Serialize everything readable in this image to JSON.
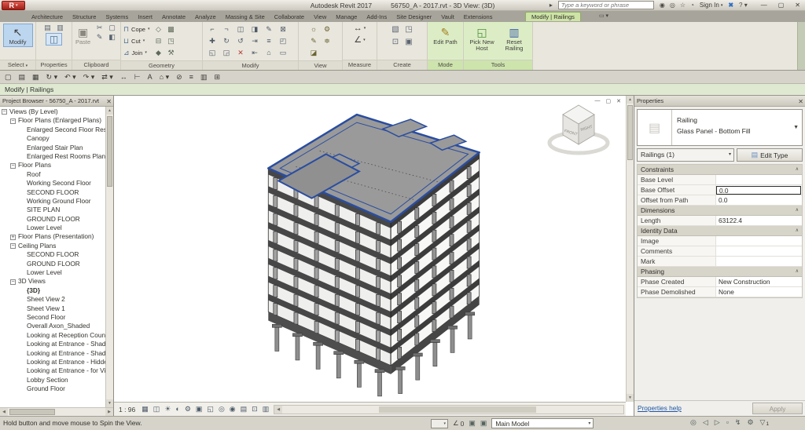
{
  "titlebar": {
    "app": "R",
    "title_left": "Autodesk Revit 2017",
    "title_right": "56750_A - 2017.rvt - 3D View: (3D)",
    "search_placeholder": "Type a keyword or phrase",
    "sign_in": "Sign In",
    "help": "?",
    "window": {
      "minimize": "—",
      "maximize": "▢",
      "close": "✕"
    }
  },
  "tabs": {
    "items": [
      {
        "label": "Architecture"
      },
      {
        "label": "Structure"
      },
      {
        "label": "Systems"
      },
      {
        "label": "Insert"
      },
      {
        "label": "Annotate"
      },
      {
        "label": "Analyze"
      },
      {
        "label": "Massing & Site"
      },
      {
        "label": "Collaborate"
      },
      {
        "label": "View"
      },
      {
        "label": "Manage"
      },
      {
        "label": "Add-Ins"
      },
      {
        "label": "Site Designer"
      },
      {
        "label": "Vault"
      },
      {
        "label": "Extensions"
      }
    ],
    "active": "Modify | Railings"
  },
  "ribbon": {
    "panels": {
      "select": "Select",
      "properties": "Properties",
      "clipboard": "Clipboard",
      "geometry": "Geometry",
      "modify": "Modify",
      "view": "View",
      "measure": "Measure",
      "create": "Create",
      "mode": "Mode",
      "tools": "Tools"
    },
    "buttons": {
      "modify": "Modify",
      "paste": "Paste",
      "cope": "Cope",
      "cut": "Cut",
      "join": "Join",
      "edit_path": "Edit Path",
      "pick_new_host": "Pick New Host",
      "reset_railing": "Reset Railing"
    }
  },
  "options_bar": {
    "label": "Modify | Railings"
  },
  "project_browser": {
    "title": "Project Browser - 56750_A - 2017.rvt",
    "tree": [
      {
        "label": "Views (By Level)",
        "level": 0,
        "exp": "minus"
      },
      {
        "label": "Floor Plans (Enlarged Plans)",
        "level": 1,
        "exp": "minus"
      },
      {
        "label": "Enlarged Second Floor Restr",
        "level": 2,
        "exp": "none"
      },
      {
        "label": "Canopy",
        "level": 2,
        "exp": "none"
      },
      {
        "label": "Enlarged Stair Plan",
        "level": 2,
        "exp": "none"
      },
      {
        "label": "Enlarged Rest Rooms Plan",
        "level": 2,
        "exp": "none"
      },
      {
        "label": "Floor Plans",
        "level": 1,
        "exp": "minus"
      },
      {
        "label": "Roof",
        "level": 2,
        "exp": "none"
      },
      {
        "label": "Working Second Floor",
        "level": 2,
        "exp": "none"
      },
      {
        "label": "SECOND FLOOR",
        "level": 2,
        "exp": "none"
      },
      {
        "label": "Working Ground Floor",
        "level": 2,
        "exp": "none"
      },
      {
        "label": "SITE PLAN",
        "level": 2,
        "exp": "none"
      },
      {
        "label": "GROUND FLOOR",
        "level": 2,
        "exp": "none"
      },
      {
        "label": "Lower Level",
        "level": 2,
        "exp": "none"
      },
      {
        "label": "Floor Plans (Presentation)",
        "level": 1,
        "exp": "plus"
      },
      {
        "label": "Ceiling Plans",
        "level": 1,
        "exp": "minus"
      },
      {
        "label": "SECOND FLOOR",
        "level": 2,
        "exp": "none"
      },
      {
        "label": "GROUND FLOOR",
        "level": 2,
        "exp": "none"
      },
      {
        "label": "Lower Level",
        "level": 2,
        "exp": "none"
      },
      {
        "label": "3D Views",
        "level": 1,
        "exp": "minus"
      },
      {
        "label": "{3D}",
        "level": 2,
        "exp": "none",
        "bold": true
      },
      {
        "label": "Sheet View 2",
        "level": 2,
        "exp": "none"
      },
      {
        "label": "Sheet View 1",
        "level": 2,
        "exp": "none"
      },
      {
        "label": "Second Floor",
        "level": 2,
        "exp": "none"
      },
      {
        "label": "Overall Axon_Shaded",
        "level": 2,
        "exp": "none"
      },
      {
        "label": "Looking at Reception Count",
        "level": 2,
        "exp": "none"
      },
      {
        "label": "Looking at Entrance - Shade",
        "level": 2,
        "exp": "none"
      },
      {
        "label": "Looking at Entrance - Shade",
        "level": 2,
        "exp": "none"
      },
      {
        "label": "Looking at Entrance - Hidde",
        "level": 2,
        "exp": "none"
      },
      {
        "label": "Looking at Entrance - for Vi",
        "level": 2,
        "exp": "none"
      },
      {
        "label": "Lobby Section",
        "level": 2,
        "exp": "none"
      },
      {
        "label": "Ground Floor",
        "level": 2,
        "exp": "none"
      }
    ]
  },
  "canvas": {
    "scale": "1 : 96"
  },
  "viewcube": {
    "front": "FRONT",
    "right": "RIGHT"
  },
  "properties": {
    "title": "Properties",
    "type_family": "Railing",
    "type_name": "Glass Panel - Bottom Fill",
    "selection": "Railings (1)",
    "edit_type": "Edit Type",
    "rows": [
      {
        "kind": "group",
        "label": "Constraints",
        "value": ""
      },
      {
        "kind": "row",
        "label": "Base Level",
        "value": ""
      },
      {
        "kind": "row",
        "label": "Base Offset",
        "value": "0.0",
        "boxed": true
      },
      {
        "kind": "row",
        "label": "Offset from Path",
        "value": "0.0"
      },
      {
        "kind": "group",
        "label": "Dimensions",
        "value": ""
      },
      {
        "kind": "row",
        "label": "Length",
        "value": "63122.4"
      },
      {
        "kind": "group",
        "label": "Identity Data",
        "value": ""
      },
      {
        "kind": "row",
        "label": "Image",
        "value": ""
      },
      {
        "kind": "row",
        "label": "Comments",
        "value": ""
      },
      {
        "kind": "row",
        "label": "Mark",
        "value": ""
      },
      {
        "kind": "group",
        "label": "Phasing",
        "value": ""
      },
      {
        "kind": "row",
        "label": "Phase Created",
        "value": "New Construction"
      },
      {
        "kind": "row",
        "label": "Phase Demolished",
        "value": "None"
      }
    ],
    "help": "Properties help",
    "apply": "Apply"
  },
  "statusbar": {
    "message": "Hold button and move mouse to Spin the View.",
    "workset_value": "0",
    "main_model": "Main Model",
    "filter_count": "1"
  },
  "icons": {
    "collapse": "∧",
    "qat": [
      {
        "name": "new-file-icon",
        "glyph": "▢"
      },
      {
        "name": "open-icon",
        "glyph": "▤"
      },
      {
        "name": "save-icon",
        "glyph": "▦"
      },
      {
        "name": "sync-icon",
        "glyph": "↻ ▾"
      },
      {
        "name": "undo-icon",
        "glyph": "↶ ▾"
      },
      {
        "name": "redo-icon",
        "glyph": "↷ ▾"
      },
      {
        "name": "transfer-icon",
        "glyph": "⇄ ▾"
      },
      {
        "name": "measure-icon",
        "glyph": "↔"
      },
      {
        "name": "aligned-dimension-icon",
        "glyph": "⊢"
      },
      {
        "name": "text-icon",
        "glyph": "A"
      },
      {
        "name": "default-3d-view-icon",
        "glyph": "⌂ ▾"
      },
      {
        "name": "section-icon",
        "glyph": "⊘"
      },
      {
        "name": "thin-lines-icon",
        "glyph": "≡"
      },
      {
        "name": "user-interface-icon",
        "glyph": "▥"
      },
      {
        "name": "close-hidden-windows-icon",
        "glyph": "⊞"
      }
    ],
    "search_cluster": [
      {
        "name": "search-icon",
        "glyph": "◉"
      },
      {
        "name": "communication-center-icon",
        "glyph": "◎"
      },
      {
        "name": "favorites-icon",
        "glyph": "☆"
      },
      {
        "name": "account-icon",
        "glyph": "◔"
      }
    ],
    "clipboard_small": [
      {
        "name": "cut-to-clipboard-icon",
        "glyph": "✂"
      },
      {
        "name": "copy-to-clipboard-icon",
        "glyph": "▢"
      },
      {
        "name": "match-type-icon",
        "glyph": "✎"
      },
      {
        "name": "paste-options-icon",
        "glyph": "◧"
      }
    ],
    "geometry_right": [
      {
        "name": "wall-joins-icon",
        "glyph": "◇"
      },
      {
        "name": "beam-joins-icon",
        "glyph": "▩"
      },
      {
        "name": "unjoin-icon",
        "glyph": "⊟"
      },
      {
        "name": "split-element-icon",
        "glyph": "◳"
      },
      {
        "name": "paint-icon",
        "glyph": "◆"
      },
      {
        "name": "demolish-icon",
        "glyph": "⚒"
      }
    ],
    "modify_grid": [
      {
        "name": "align-icon",
        "glyph": "⌐"
      },
      {
        "name": "offset-icon",
        "glyph": "¬"
      },
      {
        "name": "mirror-axis-icon",
        "glyph": "◫"
      },
      {
        "name": "mirror-pick-icon",
        "glyph": "◨"
      },
      {
        "name": "split-icon",
        "glyph": "✎"
      },
      {
        "name": "pin-icon",
        "glyph": "⊠"
      },
      {
        "name": "move-icon",
        "glyph": "✚"
      },
      {
        "name": "rotate-icon",
        "glyph": "↻"
      },
      {
        "name": "copy-icon",
        "glyph": "↺"
      },
      {
        "name": "trim-icon",
        "glyph": "⇥"
      },
      {
        "name": "array-icon",
        "glyph": "≡"
      },
      {
        "name": "scale-icon",
        "glyph": "◰"
      },
      {
        "name": "unpin-icon",
        "glyph": "◱"
      },
      {
        "name": "cut-geometry-icon",
        "glyph": "◲"
      },
      {
        "name": "delete-icon",
        "glyph": "✕",
        "color": "#b23b2e"
      },
      {
        "name": "trim-extend-icon",
        "glyph": "⇤"
      },
      {
        "name": "cut-profile-icon",
        "glyph": "⌂"
      },
      {
        "name": "split-face-icon",
        "glyph": "▭"
      }
    ],
    "view_icons": [
      {
        "name": "render-icon",
        "glyph": "☼"
      },
      {
        "name": "render-gallery-icon",
        "glyph": "⚙"
      },
      {
        "name": "thin-lines-view-icon",
        "glyph": "✎"
      },
      {
        "name": "graphic-display-icon",
        "glyph": "≑"
      },
      {
        "name": "close-inactive-views-icon",
        "glyph": "◪"
      }
    ],
    "create_icons": [
      {
        "name": "legend-component-icon",
        "glyph": "▧"
      },
      {
        "name": "create-group-icon",
        "glyph": "◳"
      },
      {
        "name": "create-similar-icon",
        "glyph": "⊡"
      },
      {
        "name": "create-assembly-icon",
        "glyph": "▣"
      }
    ],
    "viewbar": [
      {
        "name": "detail-level-icon",
        "glyph": "▦"
      },
      {
        "name": "visual-style-icon",
        "glyph": "◫"
      },
      {
        "name": "sun-path-icon",
        "glyph": "☀"
      },
      {
        "name": "shadows-icon",
        "glyph": "◐"
      },
      {
        "name": "render-view-icon",
        "glyph": "⚙"
      },
      {
        "name": "crop-view-icon",
        "glyph": "▣"
      },
      {
        "name": "crop-region-visible-icon",
        "glyph": "◱"
      },
      {
        "name": "temporary-hide-isolate-icon",
        "glyph": "◎"
      },
      {
        "name": "reveal-hidden-elements-icon",
        "glyph": "◉"
      },
      {
        "name": "temporary-view-properties-icon",
        "glyph": "▤"
      },
      {
        "name": "show-constraints-icon",
        "glyph": "⊡"
      },
      {
        "name": "worksharing-display-icon",
        "glyph": "▥"
      }
    ],
    "status_right": [
      {
        "name": "editable-only-icon",
        "glyph": "◎"
      },
      {
        "name": "select-links-icon",
        "glyph": "◁"
      },
      {
        "name": "select-underlay-icon",
        "glyph": "▷"
      },
      {
        "name": "select-pinned-icon",
        "glyph": "▫"
      },
      {
        "name": "select-by-face-icon",
        "glyph": "↯"
      },
      {
        "name": "drag-on-selection-icon",
        "glyph": "⚙"
      }
    ]
  }
}
